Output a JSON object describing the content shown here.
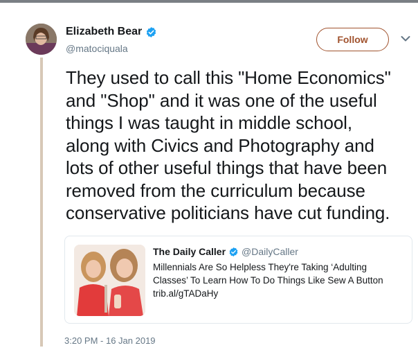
{
  "tweet": {
    "author_name": "Elizabeth Bear",
    "author_handle": "@matociquala",
    "follow_label": "Follow",
    "text": "They used to call this \"Home Economics\"\nand \"Shop\" and it was one of the useful\nthings I was taught in middle school,\nalong with Civics and Photography and\nlots of other useful things that have been\nremoved from the curriculum because\nconservative politicians have cut funding.",
    "timestamp": "3:20 PM - 16 Jan 2019"
  },
  "quoted": {
    "author_name": "The Daily Caller",
    "author_handle": "@DailyCaller",
    "text": "Millennials Are So Helpless They're Taking ‘Adulting Classes’ To Learn How To Do Things Like Sew A Button",
    "link": "trib.al/gTADaHy"
  },
  "colors": {
    "follow_accent": "#a0522d",
    "verified_blue": "#1da1f2",
    "thread_line": "#d7c8b7",
    "muted_text": "#657786"
  },
  "icons": {
    "verified": "verified-badge-icon",
    "menu": "chevron-down-icon"
  }
}
